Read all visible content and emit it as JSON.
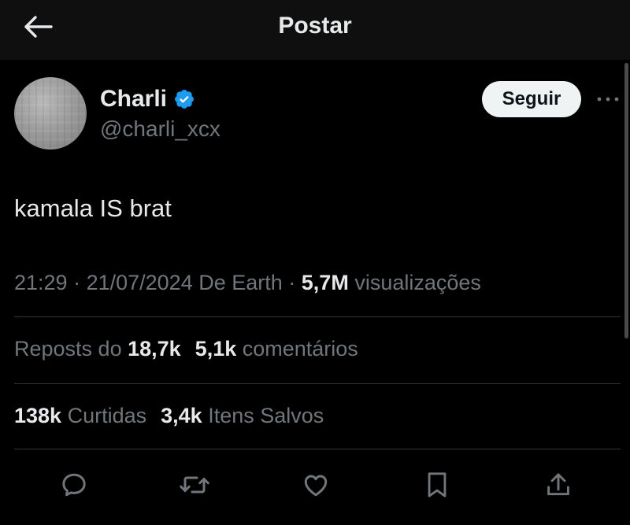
{
  "header": {
    "title": "Postar",
    "back_icon": "arrow-left-icon"
  },
  "author": {
    "name": "Charli",
    "handle": "@charli_xcx",
    "verified_color": "#1d9bf0",
    "follow_label": "Seguir",
    "more_icon": "more-horizontal-icon"
  },
  "tweet": {
    "text": "kamala IS brat"
  },
  "meta": {
    "time": "21:29",
    "sep1": " · ",
    "date": "21/07/2024",
    "source": " De Earth",
    "sep2": " · ",
    "views_count": "5,7M",
    "views_label": " visualizações"
  },
  "stats_row1": {
    "reposts_label": "Reposts do ",
    "reposts_count": "18,7k",
    "comments_count": "5,1k",
    "comments_label": " comentários"
  },
  "stats_row2": {
    "likes_count": "138k",
    "likes_label": " Curtidas",
    "saves_count": "3,4k",
    "saves_label": " Itens Salvos"
  },
  "actions": [
    {
      "icon": "reply-icon"
    },
    {
      "icon": "repost-icon"
    },
    {
      "icon": "like-icon"
    },
    {
      "icon": "bookmark-icon"
    },
    {
      "icon": "share-icon"
    }
  ],
  "colors": {
    "background": "#000000",
    "text_primary": "#e7e9ea",
    "text_secondary": "#71767b",
    "divider": "#2f3336",
    "verified": "#1d9bf0",
    "follow_bg": "#eff3f4"
  }
}
